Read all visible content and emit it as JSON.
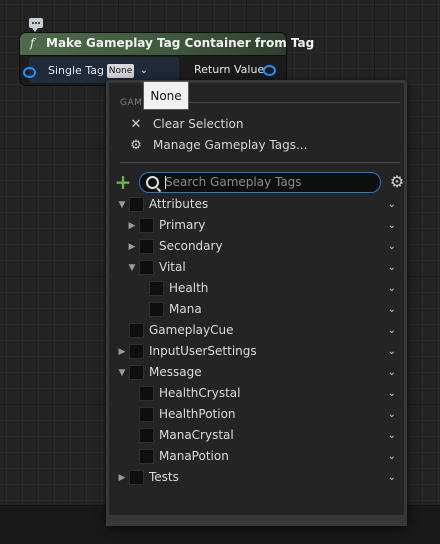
{
  "node": {
    "function_glyph": "f",
    "title": "Make Gameplay Tag Container from Tag",
    "input_label": "Single Tag",
    "input_value": "None",
    "output_label": "Return Value"
  },
  "tooltip": {
    "text": "None"
  },
  "menu": {
    "section_label": "GAM",
    "items": [
      {
        "icon": "close-icon",
        "label": "Clear Selection"
      },
      {
        "icon": "gear-icon",
        "label": "Manage Gameplay Tags..."
      }
    ]
  },
  "search": {
    "placeholder": "Search Gameplay Tags",
    "value": ""
  },
  "tree": [
    {
      "label": "Attributes",
      "depth": 0,
      "expander": "expanded"
    },
    {
      "label": "Primary",
      "depth": 1,
      "expander": "collapsed"
    },
    {
      "label": "Secondary",
      "depth": 1,
      "expander": "collapsed"
    },
    {
      "label": "Vital",
      "depth": 1,
      "expander": "expanded"
    },
    {
      "label": "Health",
      "depth": 2,
      "expander": "none"
    },
    {
      "label": "Mana",
      "depth": 2,
      "expander": "none"
    },
    {
      "label": "GameplayCue",
      "depth": 0,
      "expander": "none"
    },
    {
      "label": "InputUserSettings",
      "depth": 0,
      "expander": "collapsed"
    },
    {
      "label": "Message",
      "depth": 0,
      "expander": "expanded"
    },
    {
      "label": "HealthCrystal",
      "depth": 1,
      "expander": "none"
    },
    {
      "label": "HealthPotion",
      "depth": 1,
      "expander": "none"
    },
    {
      "label": "ManaCrystal",
      "depth": 1,
      "expander": "none"
    },
    {
      "label": "ManaPotion",
      "depth": 1,
      "expander": "none"
    },
    {
      "label": "Tests",
      "depth": 0,
      "expander": "collapsed"
    }
  ],
  "colors": {
    "pin": "#1e90ff",
    "accent_focus": "#1e7ad6",
    "add": "#6ab34a",
    "node_header": "#4f6b4b"
  }
}
